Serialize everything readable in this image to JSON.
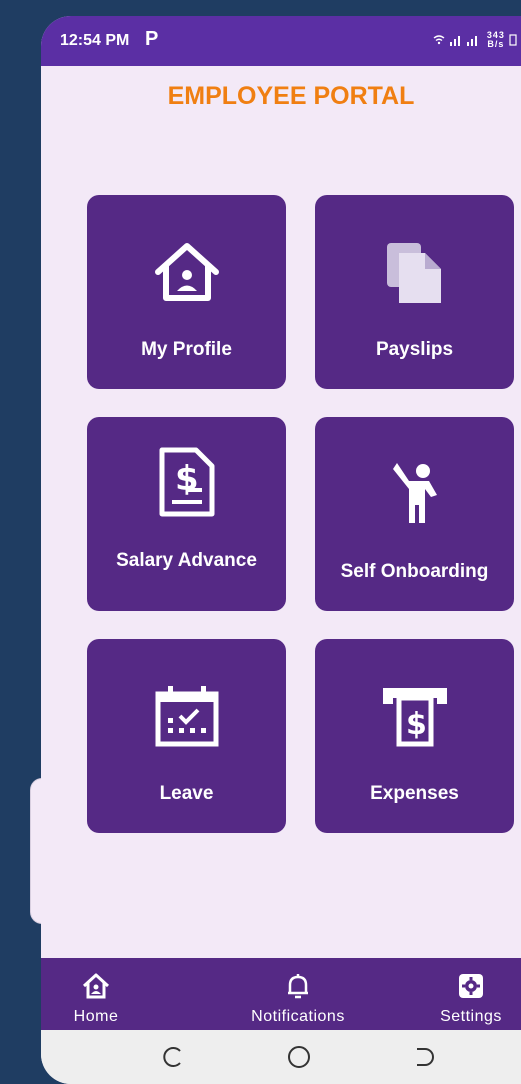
{
  "status_bar": {
    "time": "12:54 PM",
    "app_badge": "P",
    "speed_value": "343",
    "speed_unit": "B/s"
  },
  "header": {
    "title": "EMPLOYEE PORTAL"
  },
  "tiles": [
    {
      "label": "My Profile",
      "icon": "home-profile-icon"
    },
    {
      "label": "Payslips",
      "icon": "documents-icon"
    },
    {
      "label": "Salary Advance",
      "icon": "dollar-document-icon"
    },
    {
      "label": "Self Onboarding",
      "icon": "person-waving-icon"
    },
    {
      "label": "Leave",
      "icon": "calendar-check-icon"
    },
    {
      "label": "Expenses",
      "icon": "cash-withdrawal-icon"
    }
  ],
  "bottom_nav": [
    {
      "label": "Home",
      "icon": "home-icon"
    },
    {
      "label": "Notifications",
      "icon": "bell-icon"
    },
    {
      "label": "Settings",
      "icon": "gear-icon"
    }
  ],
  "colors": {
    "status_bar": "#5b2fa4",
    "tile": "#552985",
    "title": "#f07f12",
    "background": "#f3e9f7"
  }
}
